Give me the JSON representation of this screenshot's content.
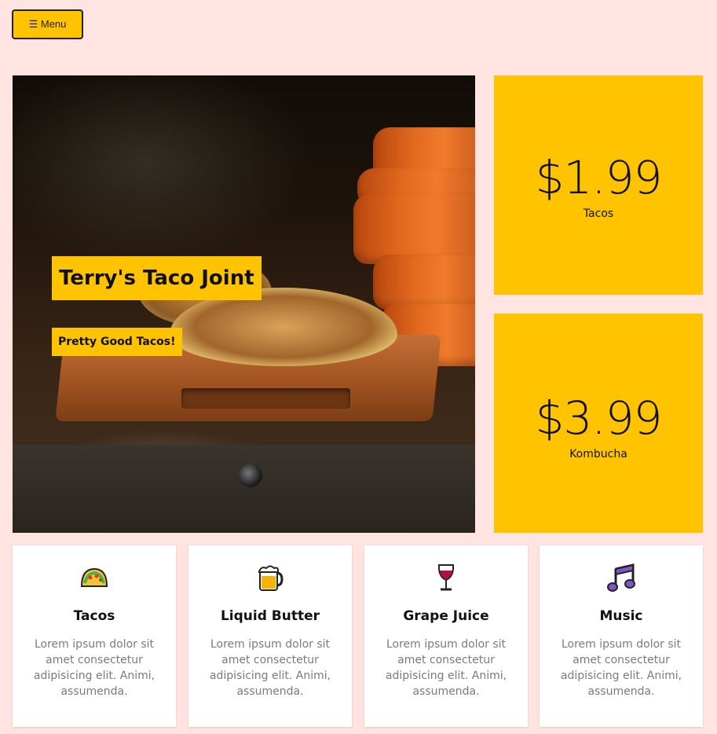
{
  "menu_button": {
    "label": "☰ Menu"
  },
  "hero": {
    "title": "Terry's Taco Joint",
    "subtitle": "Pretty Good Tacos!"
  },
  "prices": [
    {
      "amount": "$1.99",
      "item": "Tacos"
    },
    {
      "amount": "$3.99",
      "item": "Kombucha"
    }
  ],
  "features": [
    {
      "icon": "taco-icon",
      "title": "Tacos",
      "text": "Lorem ipsum dolor sit amet consectetur adipisicing elit. Animi, assumenda."
    },
    {
      "icon": "beer-mug-icon",
      "title": "Liquid Butter",
      "text": "Lorem ipsum dolor sit amet consectetur adipisicing elit. Animi, assumenda."
    },
    {
      "icon": "wine-glass-icon",
      "title": "Grape Juice",
      "text": "Lorem ipsum dolor sit amet consectetur adipisicing elit. Animi, assumenda."
    },
    {
      "icon": "music-notes-icon",
      "title": "Music",
      "text": "Lorem ipsum dolor sit amet consectetur adipisicing elit. Animi, assumenda."
    }
  ],
  "colors": {
    "accent": "#ffc300",
    "background": "#ffe4e1"
  }
}
